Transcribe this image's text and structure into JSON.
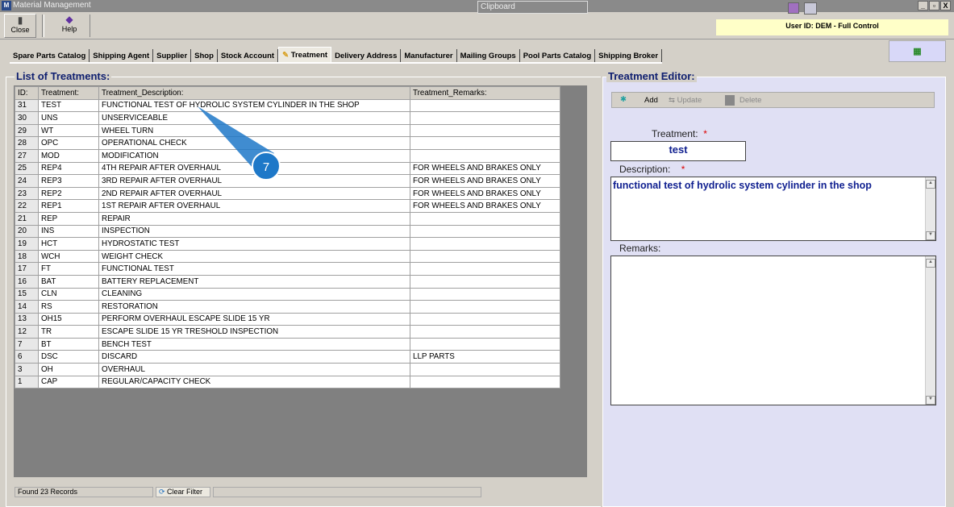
{
  "window": {
    "title": "Material Management",
    "clipboard": "Clipboard",
    "minimize": "_",
    "restore": "▫",
    "close": "X"
  },
  "toolbar": {
    "close_label": "Close",
    "help_label": "Help"
  },
  "user_id": "User ID: DEM - Full Control",
  "tabs": [
    "Spare Parts Catalog",
    "Shipping Agent",
    "Supplier",
    "Shop",
    "Stock Account",
    "Treatment",
    "Delivery Address",
    "Manufacturer",
    "Mailing Groups",
    "Pool Parts Catalog",
    "Shipping Broker"
  ],
  "list": {
    "title": "List of Treatments:",
    "columns": [
      "ID:",
      "Treatment:",
      "Treatment_Description:",
      "Treatment_Remarks:"
    ],
    "rows": [
      [
        "31",
        "TEST",
        "FUNCTIONAL TEST OF HYDROLIC SYSTEM CYLINDER IN THE SHOP",
        ""
      ],
      [
        "30",
        "UNS",
        "UNSERVICEABLE",
        ""
      ],
      [
        "29",
        "WT",
        "WHEEL TURN",
        ""
      ],
      [
        "28",
        "OPC",
        "OPERATIONAL CHECK",
        ""
      ],
      [
        "27",
        "MOD",
        "MODIFICATION",
        ""
      ],
      [
        "25",
        "REP4",
        "4TH REPAIR AFTER OVERHAUL",
        "FOR WHEELS AND BRAKES ONLY"
      ],
      [
        "24",
        "REP3",
        "3RD REPAIR AFTER OVERHAUL",
        "FOR WHEELS AND BRAKES ONLY"
      ],
      [
        "23",
        "REP2",
        "2ND REPAIR AFTER OVERHAUL",
        "FOR WHEELS AND BRAKES ONLY"
      ],
      [
        "22",
        "REP1",
        "1ST REPAIR AFTER OVERHAUL",
        "FOR WHEELS AND BRAKES ONLY"
      ],
      [
        "21",
        "REP",
        "REPAIR",
        ""
      ],
      [
        "20",
        "INS",
        "INSPECTION",
        ""
      ],
      [
        "19",
        "HCT",
        "HYDROSTATIC TEST",
        ""
      ],
      [
        "18",
        "WCH",
        "WEIGHT CHECK",
        ""
      ],
      [
        "17",
        "FT",
        "FUNCTIONAL TEST",
        ""
      ],
      [
        "16",
        "BAT",
        "BATTERY REPLACEMENT",
        ""
      ],
      [
        "15",
        "CLN",
        "CLEANING",
        ""
      ],
      [
        "14",
        "RS",
        "RESTORATION",
        ""
      ],
      [
        "13",
        "OH15",
        "PERFORM OVERHAUL ESCAPE SLIDE 15 YR",
        ""
      ],
      [
        "12",
        "TR",
        "ESCAPE SLIDE 15 YR TRESHOLD INSPECTION",
        ""
      ],
      [
        "7",
        "BT",
        "BENCH TEST",
        ""
      ],
      [
        "6",
        "DSC",
        "DISCARD",
        "LLP PARTS"
      ],
      [
        "3",
        "OH",
        "OVERHAUL",
        ""
      ],
      [
        "1",
        "CAP",
        "REGULAR/CAPACITY CHECK",
        ""
      ]
    ]
  },
  "status": {
    "found": "Found 23 Records",
    "clear_filter": "Clear Filter"
  },
  "editor": {
    "title": "Treatment Editor:",
    "add": "Add",
    "update": "Update",
    "delete": "Delete",
    "treatment_label": "Treatment:",
    "treatment_value": "test",
    "description_label": "Description:",
    "description_value": "functional test of hydrolic system cylinder in the shop",
    "remarks_label": "Remarks:",
    "remarks_value": "",
    "required": "*"
  },
  "annotation": {
    "marker": "7"
  }
}
